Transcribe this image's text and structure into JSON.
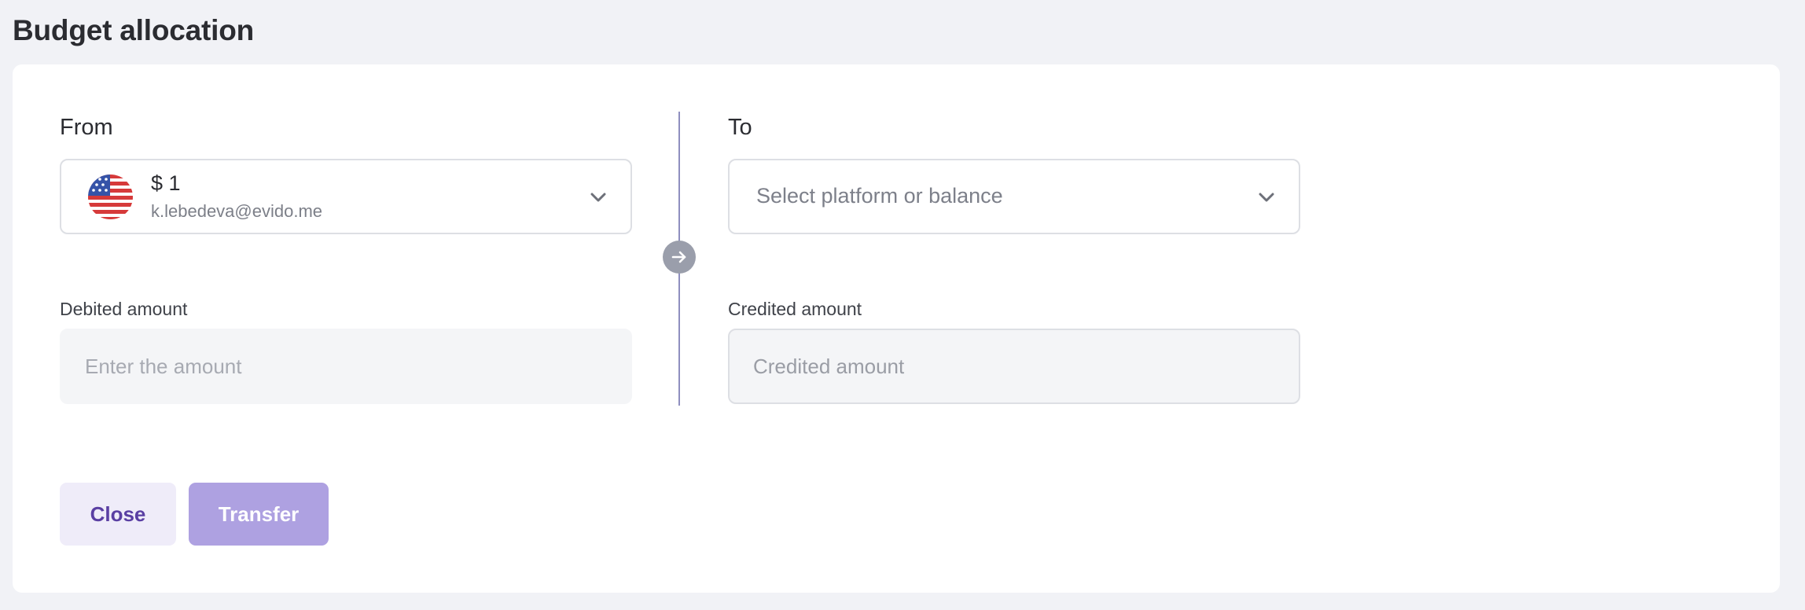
{
  "page": {
    "title": "Budget allocation"
  },
  "from": {
    "label": "From",
    "selected": {
      "amount": "$ 1",
      "email": "k.lebedeva@evido.me",
      "icon": "us-flag-icon"
    },
    "debited_label": "Debited amount",
    "debited_placeholder": "Enter the amount"
  },
  "to": {
    "label": "To",
    "select_placeholder": "Select platform or balance",
    "credited_label": "Credited amount",
    "credited_placeholder": "Credited amount"
  },
  "actions": {
    "close_label": "Close",
    "transfer_label": "Transfer"
  },
  "colors": {
    "accent": "#5a3fa3",
    "transfer_button": "#aea1e1",
    "close_button_bg": "#efecf9",
    "divider": "#8f8fbf"
  }
}
